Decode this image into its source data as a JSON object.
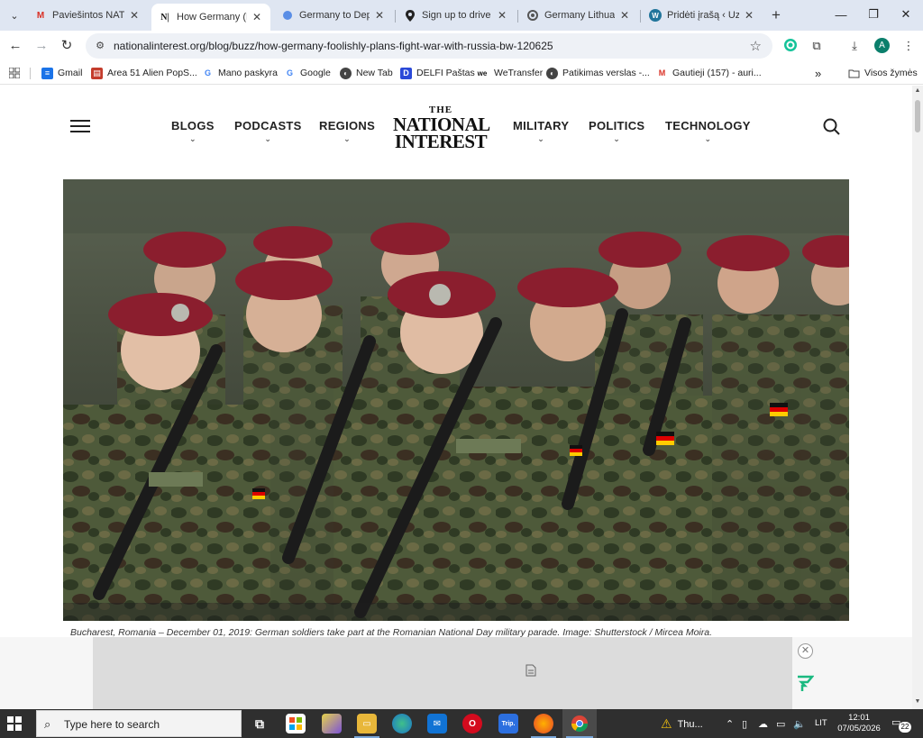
{
  "browser": {
    "tabs": [
      {
        "label": "Paviešintos NATO-",
        "icon": "gmail-icon",
        "active": false
      },
      {
        "label": "How Germany (Fo",
        "icon": "ni-icon",
        "active": true
      },
      {
        "label": "Germany to Deplo",
        "icon": "globe-icon",
        "active": false
      },
      {
        "label": "Sign up to drive w",
        "icon": "location-pin-icon",
        "active": false
      },
      {
        "label": "Germany Lithuania",
        "icon": "chrome-gray-icon",
        "active": false
      },
      {
        "label": "Pridėti įrašą ‹ Uzdr",
        "icon": "wordpress-icon",
        "active": false
      }
    ],
    "tab_icon_glyphs": {
      "ni": "N|",
      "gmail": "M",
      "wordpress": "W"
    },
    "url": "nationalinterest.org/blog/buzz/how-germany-foolishly-plans-fight-war-with-russia-bw-120625",
    "avatar_letter": "A",
    "bookmarks": [
      {
        "label": "Gmail",
        "icon": "gmail-doc-icon"
      },
      {
        "label": "Area 51 Alien PopS...",
        "icon": "store-icon"
      },
      {
        "label": "Mano paskyra",
        "icon": "google-icon"
      },
      {
        "label": "Google",
        "icon": "google-icon"
      },
      {
        "label": "New Tab",
        "icon": "globe-icon"
      },
      {
        "label": "DELFI Paštas",
        "icon": "delfi-icon"
      },
      {
        "label": "WeTransfer",
        "icon": "wetransfer-icon"
      },
      {
        "label": "Patikimas verslas -...",
        "icon": "globe-icon"
      },
      {
        "label": "Gautieji (157) - auri...",
        "icon": "gmail-icon"
      }
    ],
    "bookmark_glyphs": {
      "delfi": "D",
      "gmail": "M",
      "google": "G",
      "wetransfer": "we"
    },
    "all_bookmarks_label": "Visos žymės"
  },
  "site": {
    "nav_left": [
      "BLOGS",
      "PODCASTS",
      "REGIONS"
    ],
    "nav_right": [
      "MILITARY",
      "POLITICS",
      "TECHNOLOGY"
    ],
    "logo": {
      "line1": "THE",
      "line2": "NATIONAL",
      "line3": "INTEREST"
    },
    "caption": "Bucharest, Romania – December 01, 2019: German soldiers take part at the Romanian National Day military parade. Image: Shutterstock / Mircea Moira."
  },
  "taskbar": {
    "search_placeholder": "Type here to search",
    "weather_label": "Thu...",
    "language": "LIT",
    "time": "12:01",
    "date": "07/05/2026",
    "notification_count": "22",
    "app_glyphs": {
      "opera": "O",
      "trip": "Trip."
    }
  },
  "colors": {
    "tabstrip_bg": "#dfe6f2",
    "beret": "#8b1e2e",
    "taskbar_bg": "#2f2f2f"
  }
}
